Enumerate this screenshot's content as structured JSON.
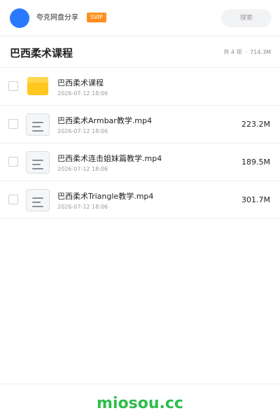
{
  "header": {
    "app_name": "夸克网盘分享",
    "badge": "SVIP",
    "search_label": "搜索",
    "avatar_color": "#2979ff",
    "badge_color": "#ff8f1f"
  },
  "folder": {
    "title": "巴西柔术课程",
    "count_text": "共 4 项",
    "separator": "·",
    "total_size": "714.3M"
  },
  "items": [
    {
      "type": "folder",
      "icon": "folder-icon",
      "name": "巴西柔术课程",
      "date": "2026-07-12 18:06",
      "size": ""
    },
    {
      "type": "file",
      "icon": "file-icon",
      "name": "巴西柔术Armbar教学.mp4",
      "date": "2026-07-12 18:06",
      "size": "223.2M"
    },
    {
      "type": "file",
      "icon": "file-icon",
      "name": "巴西柔术连击姐妹篇教学.mp4",
      "date": "2026-07-12 18:06",
      "size": "189.5M"
    },
    {
      "type": "file",
      "icon": "file-icon",
      "name": "巴西柔术Triangle教学.mp4",
      "date": "2026-07-12 18:06",
      "size": "301.7M"
    }
  ],
  "footer": {
    "watermark": "miosou.cc",
    "watermark_color": "#2ebd4b"
  }
}
